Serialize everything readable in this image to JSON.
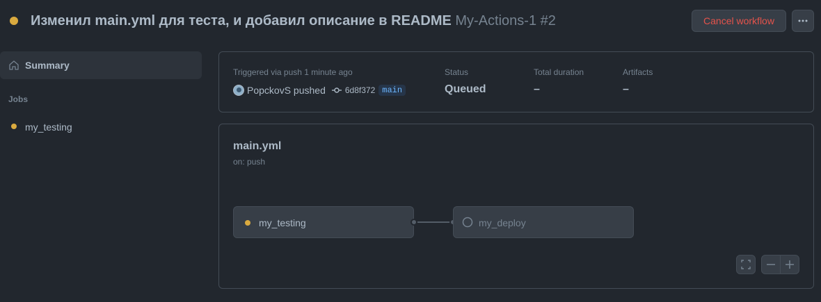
{
  "header": {
    "title": "Изменил main.yml для теста, и добавил описание в README",
    "repo_run": "My-Actions-1 #2",
    "cancel_label": "Cancel workflow",
    "status_color": "#daaa3f"
  },
  "sidebar": {
    "summary_label": "Summary",
    "jobs_heading": "Jobs",
    "jobs": [
      {
        "label": "my_testing",
        "status": "queued"
      }
    ]
  },
  "summary": {
    "trigger_label": "Triggered via push 1 minute ago",
    "trigger_user": "PopckovS pushed",
    "commit_sha": "6d8f372",
    "branch": "main",
    "status_label": "Status",
    "status_value": "Queued",
    "duration_label": "Total duration",
    "duration_value": "–",
    "artifacts_label": "Artifacts",
    "artifacts_value": "–"
  },
  "graph": {
    "workflow_name": "main.yml",
    "trigger": "on: push",
    "jobs": [
      {
        "label": "my_testing",
        "status": "queued"
      },
      {
        "label": "my_deploy",
        "status": "pending"
      }
    ]
  },
  "icons": [
    "home-icon",
    "kebab-icon",
    "commit-icon",
    "fullscreen-icon",
    "zoom-out-icon",
    "zoom-in-icon",
    "pending-circle-icon"
  ]
}
